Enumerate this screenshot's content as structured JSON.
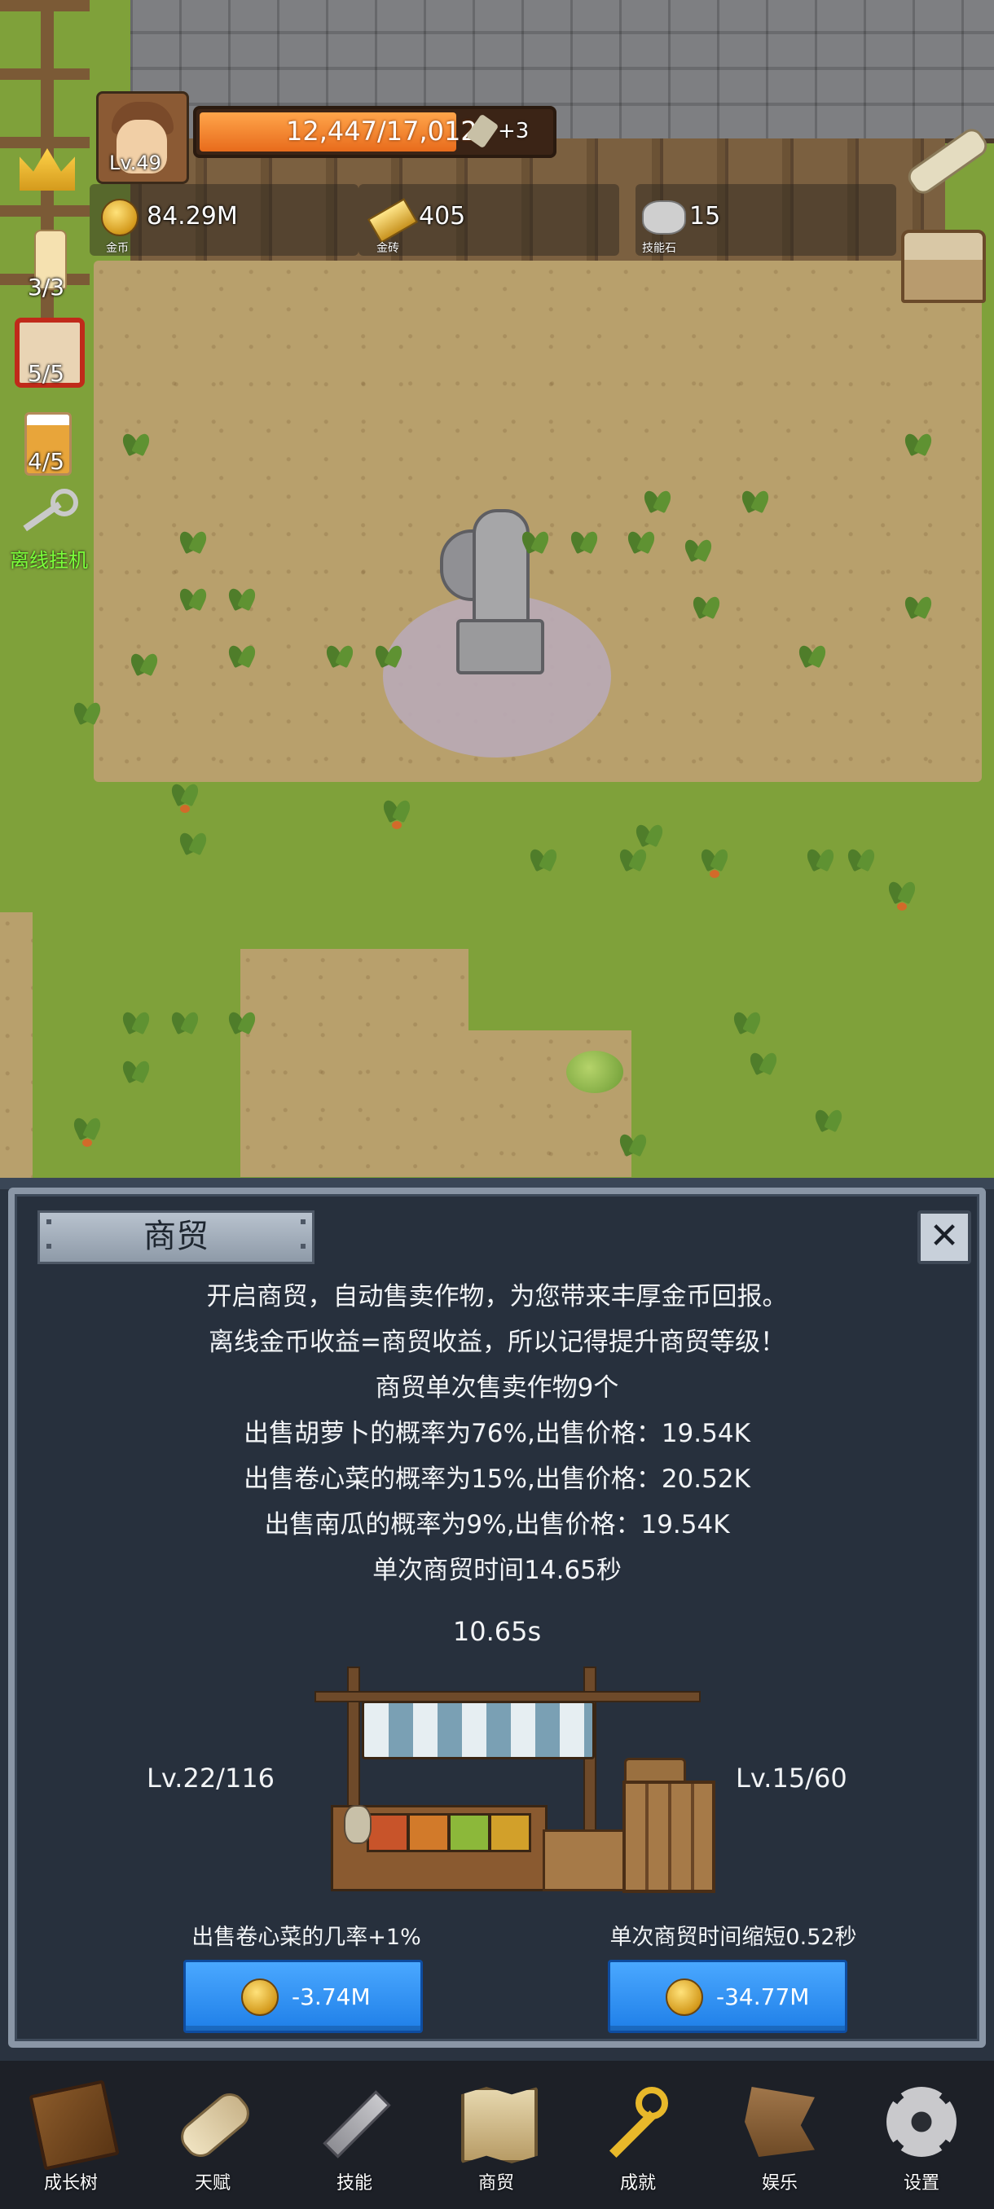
{
  "hud": {
    "player_level": "Lv.49",
    "exp": {
      "text": "12,447/17,012",
      "fraction": 0.7317,
      "bonus": "+3"
    },
    "resources": [
      {
        "icon": "gold-coin-icon",
        "value": "84.29M",
        "caption": "金币"
      },
      {
        "icon": "gold-brick-icon",
        "value": "405",
        "caption": "金砖"
      },
      {
        "icon": "skill-stone-icon",
        "value": "15",
        "caption": "技能石"
      }
    ],
    "side": {
      "candle_count": "3/3",
      "dice_count": "5/5",
      "beer_count": "4/5",
      "auto_label": "离线挂机"
    }
  },
  "panel": {
    "title": "商贸",
    "close_icon": "close-icon",
    "description": [
      "开启商贸，自动售卖作物，为您带来丰厚金币回报。",
      "离线金币收益=商贸收益，所以记得提升商贸等级！",
      "商贸单次售卖作物9个",
      "出售胡萝卜的概率为76%,出售价格：19.54K",
      "出售卷心菜的概率为15%,出售价格：20.52K",
      "出售南瓜的概率为9%,出售价格：19.54K",
      "单次商贸时间14.65秒"
    ],
    "timer": "10.65s",
    "left_level": "Lv.22/116",
    "right_level": "Lv.15/60",
    "upgrades": [
      {
        "label": "出售卷心菜的几率+1%",
        "cost": "-3.74M"
      },
      {
        "label": "单次商贸时间缩短0.52秒",
        "cost": "-34.77M"
      }
    ]
  },
  "nav": [
    {
      "label": "成长树",
      "icon": "book-icon"
    },
    {
      "label": "天赋",
      "icon": "scroll-icon"
    },
    {
      "label": "技能",
      "icon": "sword-icon"
    },
    {
      "label": "商贸",
      "icon": "map-icon"
    },
    {
      "label": "成就",
      "icon": "key-icon"
    },
    {
      "label": "娱乐",
      "icon": "flag-icon"
    },
    {
      "label": "设置",
      "icon": "gear-icon"
    }
  ],
  "colors": {
    "exp_fill": "#f0801e",
    "button_blue": "#2e8ff2",
    "panel_bg": "#27303d",
    "auto_label": "#7aff3a"
  }
}
